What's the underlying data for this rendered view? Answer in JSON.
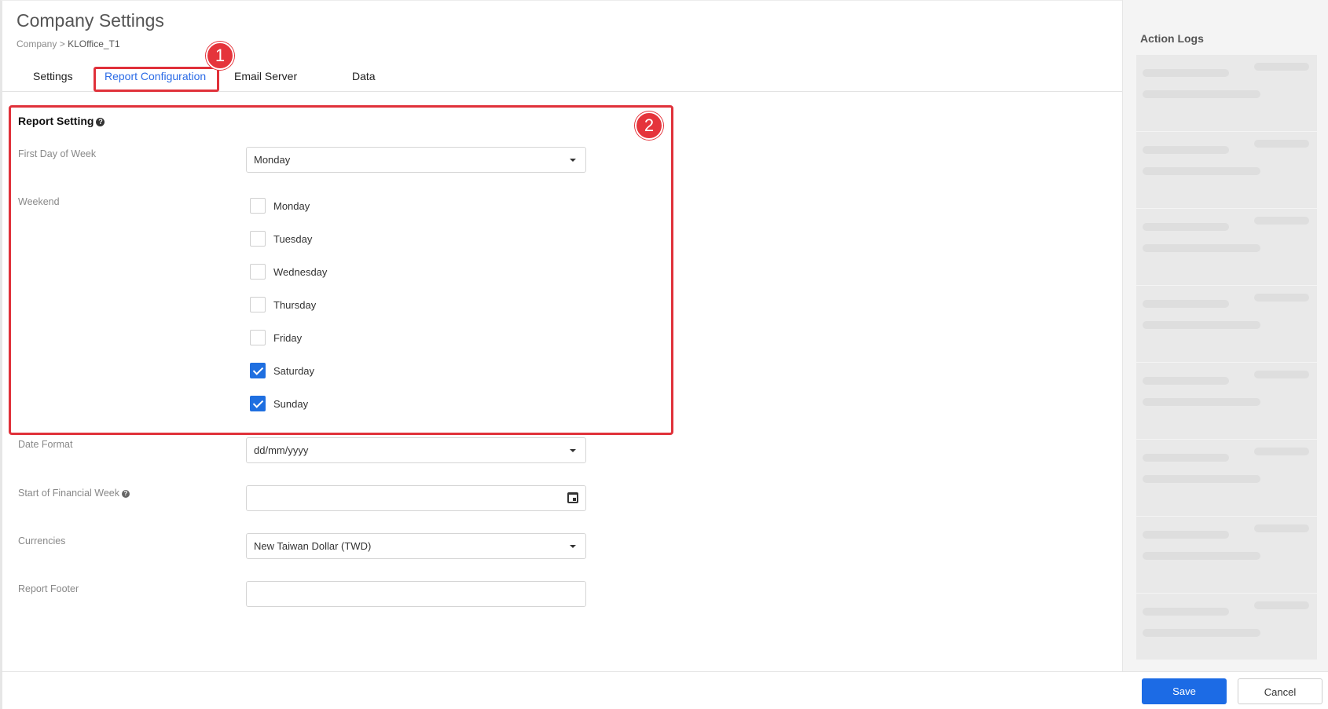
{
  "header": {
    "title": "Company Settings",
    "breadcrumb_parent": "Company",
    "breadcrumb_sep": ">",
    "breadcrumb_current": "KLOffice_T1"
  },
  "tabs": [
    {
      "label": "Settings"
    },
    {
      "label": "Report Configuration",
      "active": true
    },
    {
      "label": "Email Server"
    },
    {
      "label": "Data"
    }
  ],
  "markers": {
    "one": "1",
    "two": "2"
  },
  "report_setting": {
    "title": "Report Setting",
    "first_day_label": "First Day of Week",
    "first_day_value": "Monday",
    "weekend_label": "Weekend",
    "weekend_days": [
      {
        "label": "Monday",
        "checked": false
      },
      {
        "label": "Tuesday",
        "checked": false
      },
      {
        "label": "Wednesday",
        "checked": false
      },
      {
        "label": "Thursday",
        "checked": false
      },
      {
        "label": "Friday",
        "checked": false
      },
      {
        "label": "Saturday",
        "checked": true
      },
      {
        "label": "Sunday",
        "checked": true
      }
    ]
  },
  "fields": {
    "date_format_label": "Date Format",
    "date_format_value": "dd/mm/yyyy",
    "financial_week_label": "Start of Financial Week",
    "financial_week_value": "",
    "currencies_label": "Currencies",
    "currencies_value": "New Taiwan Dollar (TWD)",
    "report_footer_label": "Report Footer",
    "report_footer_value": ""
  },
  "side_panel": {
    "title": "Action Logs"
  },
  "footer": {
    "save_label": "Save",
    "cancel_label": "Cancel"
  },
  "colors": {
    "accent": "#1c6be5",
    "highlight": "#e0313a"
  }
}
